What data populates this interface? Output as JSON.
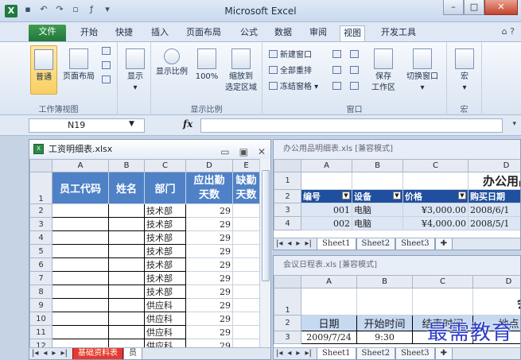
{
  "app": {
    "title": "Microsoft Excel",
    "logo": "X"
  },
  "tabs": [
    "文件",
    "开始",
    "快捷",
    "插入",
    "页面布局",
    "公式",
    "数据",
    "审阅",
    "视图",
    "开发工具"
  ],
  "ribbon": {
    "group1": {
      "name": "工作簿视图",
      "normal": "普通",
      "page_layout": "页面布局"
    },
    "group2": {
      "show": "显示"
    },
    "group3": {
      "name": "显示比例",
      "zoom": "显示比例",
      "hundred": "100%",
      "zoom_sel_1": "缩放到",
      "zoom_sel_2": "选定区域"
    },
    "group4": {
      "name": "窗口",
      "new_win": "新建窗口",
      "arrange": "全部重排",
      "freeze": "冻结窗格",
      "save_ws_1": "保存",
      "save_ws_2": "工作区",
      "switch": "切换窗口"
    },
    "group5": {
      "name": "宏",
      "macro": "宏"
    }
  },
  "formula": {
    "cell": "N19",
    "fx": "fx"
  },
  "win1": {
    "title": "工资明细表.xlsx",
    "cols": [
      "A",
      "B",
      "C",
      "D",
      "E"
    ],
    "hdr": {
      "a": "员工代码",
      "b": "姓名",
      "c": "部门",
      "d1": "应出勤",
      "d2": "天数",
      "e1": "缺勤",
      "e2": "天数"
    },
    "rows": [
      {
        "r": "2",
        "c": "技术部",
        "d": "29"
      },
      {
        "r": "3",
        "c": "技术部",
        "d": "29"
      },
      {
        "r": "4",
        "c": "技术部",
        "d": "29"
      },
      {
        "r": "5",
        "c": "技术部",
        "d": "29"
      },
      {
        "r": "6",
        "c": "技术部",
        "d": "29"
      },
      {
        "r": "7",
        "c": "技术部",
        "d": "29"
      },
      {
        "r": "8",
        "c": "技术部",
        "d": "29"
      },
      {
        "r": "9",
        "c": "供应科",
        "d": "29"
      },
      {
        "r": "10",
        "c": "供应科",
        "d": "29"
      },
      {
        "r": "11",
        "c": "供应科",
        "d": "29"
      },
      {
        "r": "12",
        "c": "供应科",
        "d": "29"
      }
    ],
    "row1": "1",
    "tab1": "基础资料表",
    "tab2": "员"
  },
  "win2": {
    "title": "办公用品明细表.xls  [兼容模式]",
    "cols": [
      "A",
      "B",
      "C",
      "D"
    ],
    "banner": "办公用品明",
    "hdr": [
      "编号",
      "设备",
      "价格",
      "购买日期"
    ],
    "rows": [
      {
        "r": "3",
        "a": "001",
        "b": "电脑",
        "c": "¥3,000.00",
        "d": "2008/6/1"
      },
      {
        "r": "4",
        "a": "002",
        "b": "电脑",
        "c": "¥4,000.00",
        "d": "2008/5/1"
      }
    ],
    "rownums": [
      "1",
      "2"
    ],
    "sheets": [
      "Sheet1",
      "Sheet2",
      "Sheet3"
    ]
  },
  "win3": {
    "title": "会议日程表.xls  [兼容模式]",
    "cols": [
      "A",
      "B",
      "C",
      "D"
    ],
    "banner": "会议",
    "hdr": [
      "日期",
      "开始时间",
      "结束时间",
      "地点"
    ],
    "row3": {
      "a": "2009/7/24",
      "b": "9:30",
      "c": "",
      "d": ""
    },
    "rownums": [
      "1",
      "2",
      "3"
    ],
    "sheets": [
      "Sheet1",
      "Sheet2",
      "Sheet3"
    ]
  },
  "watermark": "最需教育"
}
